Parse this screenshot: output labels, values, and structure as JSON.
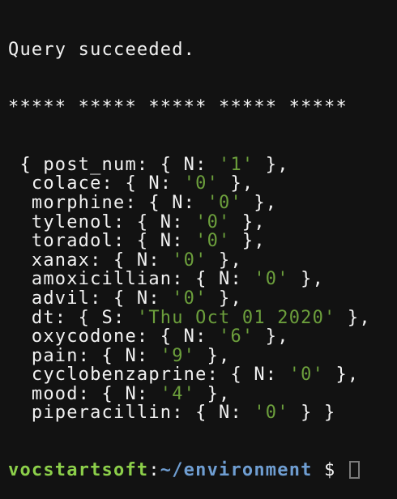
{
  "status": "Query succeeded.",
  "separator": "***** ***** ***** ***** *****",
  "record": [
    {
      "pre": " { post_num: { N: ",
      "val": "'1'",
      "post": " },"
    },
    {
      "pre": "  colace: { N: ",
      "val": "'0'",
      "post": " },"
    },
    {
      "pre": "  morphine: { N: ",
      "val": "'0'",
      "post": " },"
    },
    {
      "pre": "  tylenol: { N: ",
      "val": "'0'",
      "post": " },"
    },
    {
      "pre": "  toradol: { N: ",
      "val": "'0'",
      "post": " },"
    },
    {
      "pre": "  xanax: { N: ",
      "val": "'0'",
      "post": " },"
    },
    {
      "pre": "  amoxicillian: { N: ",
      "val": "'0'",
      "post": " },"
    },
    {
      "pre": "  advil: { N: ",
      "val": "'0'",
      "post": " },"
    },
    {
      "pre": "  dt: { S: ",
      "val": "'Thu Oct 01 2020'",
      "post": " },"
    },
    {
      "pre": "  oxycodone: { N: ",
      "val": "'6'",
      "post": " },"
    },
    {
      "pre": "  pain: { N: ",
      "val": "'9'",
      "post": " },"
    },
    {
      "pre": "  cyclobenzaprine: { N: ",
      "val": "'0'",
      "post": " },"
    },
    {
      "pre": "  mood: { N: ",
      "val": "'4'",
      "post": " },"
    },
    {
      "pre": "  piperacillin: { N: ",
      "val": "'0'",
      "post": " } }"
    }
  ],
  "prompt": {
    "user": "vocstartsoft",
    "colon": ":",
    "path": "~/environment",
    "symbol": " $ "
  },
  "colors": {
    "background": "#121212",
    "string": "#6c9f3c",
    "user": "#8ccf4a",
    "path": "#6f9ed2"
  }
}
